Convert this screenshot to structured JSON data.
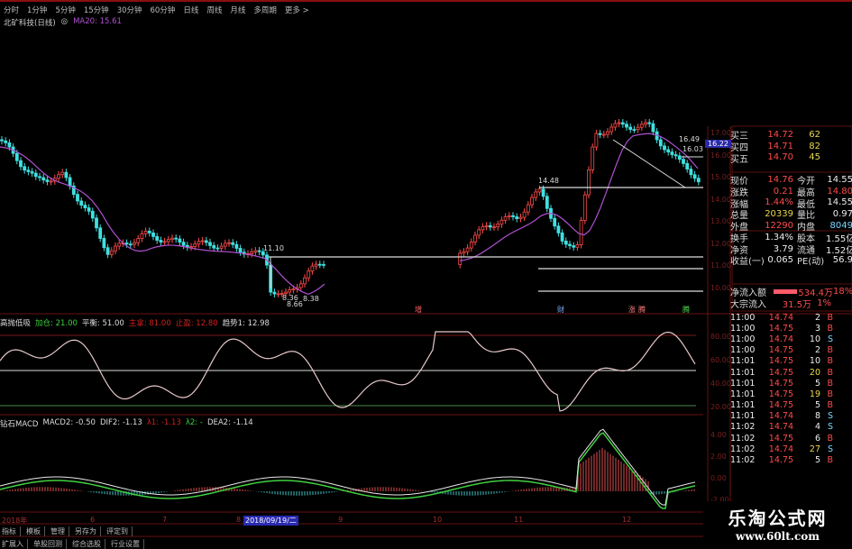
{
  "toolbar": {
    "periods": [
      "分时",
      "1分钟",
      "5分钟",
      "15分钟",
      "30分钟",
      "60分钟",
      "日线",
      "周线",
      "月线",
      "多周期",
      "更多 >"
    ]
  },
  "title": {
    "stock": "北矿科技(日线)",
    "icon": "target-icon",
    "ma": "MA20: 15.61"
  },
  "main_chart": {
    "price_axis": [
      "17.00",
      "16.00",
      "15.00",
      "14.00",
      "13.00",
      "12.00",
      "11.00",
      "10.00"
    ],
    "annotations": {
      "low_left_high": "11.10",
      "low_a": "8.38",
      "low_b": "8.36",
      "low_c": "8.66",
      "peak_mid": "14.48",
      "peak_right": "16.49",
      "level_right": "16.03",
      "current_price_tag": "16.22"
    },
    "event_markers": [
      "增",
      "财",
      "涨",
      "腾",
      "腾"
    ]
  },
  "indicator1": {
    "name": "高抛低吸",
    "items": [
      {
        "label": "加仓: 21.00",
        "color": "#3bd43b"
      },
      {
        "label": "平衡: 51.00",
        "color": "#dddddd"
      },
      {
        "label": "主拿: 81.00",
        "color": "#d02020"
      },
      {
        "label": "止盈: 12.80",
        "color": "#d02020"
      },
      {
        "label": "趋势1: 12.98",
        "color": "#dddddd"
      }
    ],
    "axis": [
      "80.00",
      "60.00",
      "40.00",
      "20.00"
    ]
  },
  "indicator2": {
    "name": "钻石MACD",
    "items": [
      {
        "label": "MACD2: -0.50",
        "color": "#dddddd"
      },
      {
        "label": "DIF2: -1.13",
        "color": "#dddddd"
      },
      {
        "label": "λ1: -1.13",
        "color": "#d02020"
      },
      {
        "label": "λ2: -",
        "color": "#3bd43b"
      },
      {
        "label": "DEA2: -1.14",
        "color": "#dddddd"
      }
    ],
    "axis": [
      "4.00",
      "2.00",
      "0.00",
      "-2.00"
    ]
  },
  "date_axis": {
    "labels": [
      "2018年",
      "6",
      "7",
      "8",
      "9",
      "10",
      "11",
      "12"
    ],
    "cursor_date": "2018/09/19/二"
  },
  "quote_panel": {
    "book": [
      {
        "label": "买三",
        "price": "14.72",
        "vol": "62"
      },
      {
        "label": "买四",
        "price": "14.71",
        "vol": "82"
      },
      {
        "label": "买五",
        "price": "14.70",
        "vol": "45"
      }
    ],
    "stats": [
      {
        "l": "现价",
        "v": "14.76",
        "l2": "今开",
        "v2": "14.55"
      },
      {
        "l": "涨跌",
        "v": "0.21",
        "l2": "最高",
        "v2": "14.80"
      },
      {
        "l": "涨幅",
        "v": "1.44%",
        "l2": "最低",
        "v2": "14.55"
      },
      {
        "l": "总量",
        "v": "20339",
        "l2": "量比",
        "v2": "0.97"
      },
      {
        "l": "外盘",
        "v": "12290",
        "l2": "内盘",
        "v2": "8049"
      },
      {
        "l": "换手",
        "v": "1.34%",
        "l2": "股本",
        "v2": "1.55亿"
      },
      {
        "l": "净资",
        "v": "3.79",
        "l2": "流通",
        "v2": "1.52亿"
      },
      {
        "l": "收益(一)",
        "v": "0.065",
        "l2": "PE(动)",
        "v2": "56.9"
      }
    ],
    "flows": [
      {
        "label": "净流入额",
        "value": "534.4万",
        "pct": "18%"
      },
      {
        "label": "大宗流入",
        "value": "31.5万",
        "pct": "1%"
      }
    ],
    "ticks": [
      {
        "t": "11:00",
        "p": "14.74",
        "n": "2",
        "s": "B"
      },
      {
        "t": "11:00",
        "p": "14.75",
        "n": "3",
        "s": "B"
      },
      {
        "t": "11:00",
        "p": "14.74",
        "n": "10",
        "s": "S"
      },
      {
        "t": "11:00",
        "p": "14.75",
        "n": "2",
        "s": "B"
      },
      {
        "t": "11:01",
        "p": "14.75",
        "n": "10",
        "s": "B"
      },
      {
        "t": "11:01",
        "p": "14.75",
        "n": "20",
        "s": "B"
      },
      {
        "t": "11:01",
        "p": "14.75",
        "n": "5",
        "s": "B"
      },
      {
        "t": "11:01",
        "p": "14.75",
        "n": "19",
        "s": "B"
      },
      {
        "t": "11:01",
        "p": "14.75",
        "n": "5",
        "s": "B"
      },
      {
        "t": "11:01",
        "p": "14.74",
        "n": "8",
        "s": "S"
      },
      {
        "t": "11:02",
        "p": "14.74",
        "n": "4",
        "s": "S"
      },
      {
        "t": "11:02",
        "p": "14.75",
        "n": "6",
        "s": "B"
      },
      {
        "t": "11:02",
        "p": "14.74",
        "n": "27",
        "s": "S"
      },
      {
        "t": "11:02",
        "p": "14.75",
        "n": "5",
        "s": "B"
      }
    ]
  },
  "footer": {
    "row1": [
      "指标",
      "模板",
      "管理",
      "另存为",
      "评定到"
    ],
    "row2": [
      "扩展入",
      "单股回测",
      "综合选股",
      "行业设置"
    ]
  },
  "watermark": {
    "title": "乐淘公式网",
    "url": "www.60lt.com"
  },
  "colors": {
    "up": "#ff4b4b",
    "down": "#40e0e0",
    "ma": "#b050d0",
    "grid": "#6a1010",
    "buy": "#ff4b4b",
    "sell": "#7ad7ff"
  }
}
